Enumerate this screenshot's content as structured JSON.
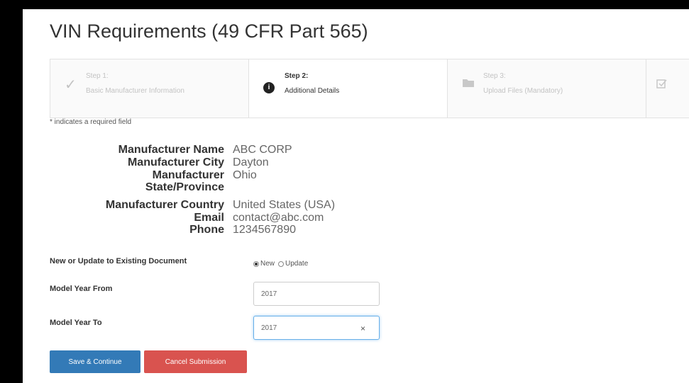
{
  "page": {
    "title": "VIN Requirements (49 CFR Part 565)",
    "required_note": "* indicates a required field"
  },
  "wizard": {
    "steps": [
      {
        "number": "Step 1:",
        "label": "Basic Manufacturer Information",
        "icon": "checkmark-icon",
        "state": "complete"
      },
      {
        "number": "Step 2:",
        "label": "Additional Details",
        "icon": "info-circle-icon",
        "state": "active"
      },
      {
        "number": "Step 3:",
        "label": "Upload Files (Mandatory)",
        "icon": "folder-icon",
        "state": "pending"
      },
      {
        "number": "",
        "label": "",
        "icon": "checkbox-icon",
        "state": "pending"
      }
    ]
  },
  "manufacturer": {
    "name_label": "Manufacturer Name",
    "name_value": "ABC CORP",
    "city_label": "Manufacturer City",
    "city_value": "Dayton",
    "state_label_1": "Manufacturer",
    "state_label_2": "State/Province",
    "state_value": "Ohio",
    "country_label": "Manufacturer Country",
    "country_value": "United States (USA)",
    "email_label": "Email",
    "email_value": "contact@abc.com",
    "phone_label": "Phone",
    "phone_value": "1234567890"
  },
  "form": {
    "doc_type_label": "New or Update to Existing Document",
    "doc_type_options": [
      "New",
      "Update"
    ],
    "doc_type_selected": "New",
    "model_year_from_label": "Model Year From",
    "model_year_from_value": "2017",
    "model_year_to_label": "Model Year To",
    "model_year_to_value": "2017",
    "clear_symbol": "×"
  },
  "buttons": {
    "save_label": "Save & Continue",
    "cancel_label": "Cancel Submission"
  },
  "colors": {
    "primary": "#337ab7",
    "danger": "#d9534f",
    "focus_border": "#66afe9"
  }
}
